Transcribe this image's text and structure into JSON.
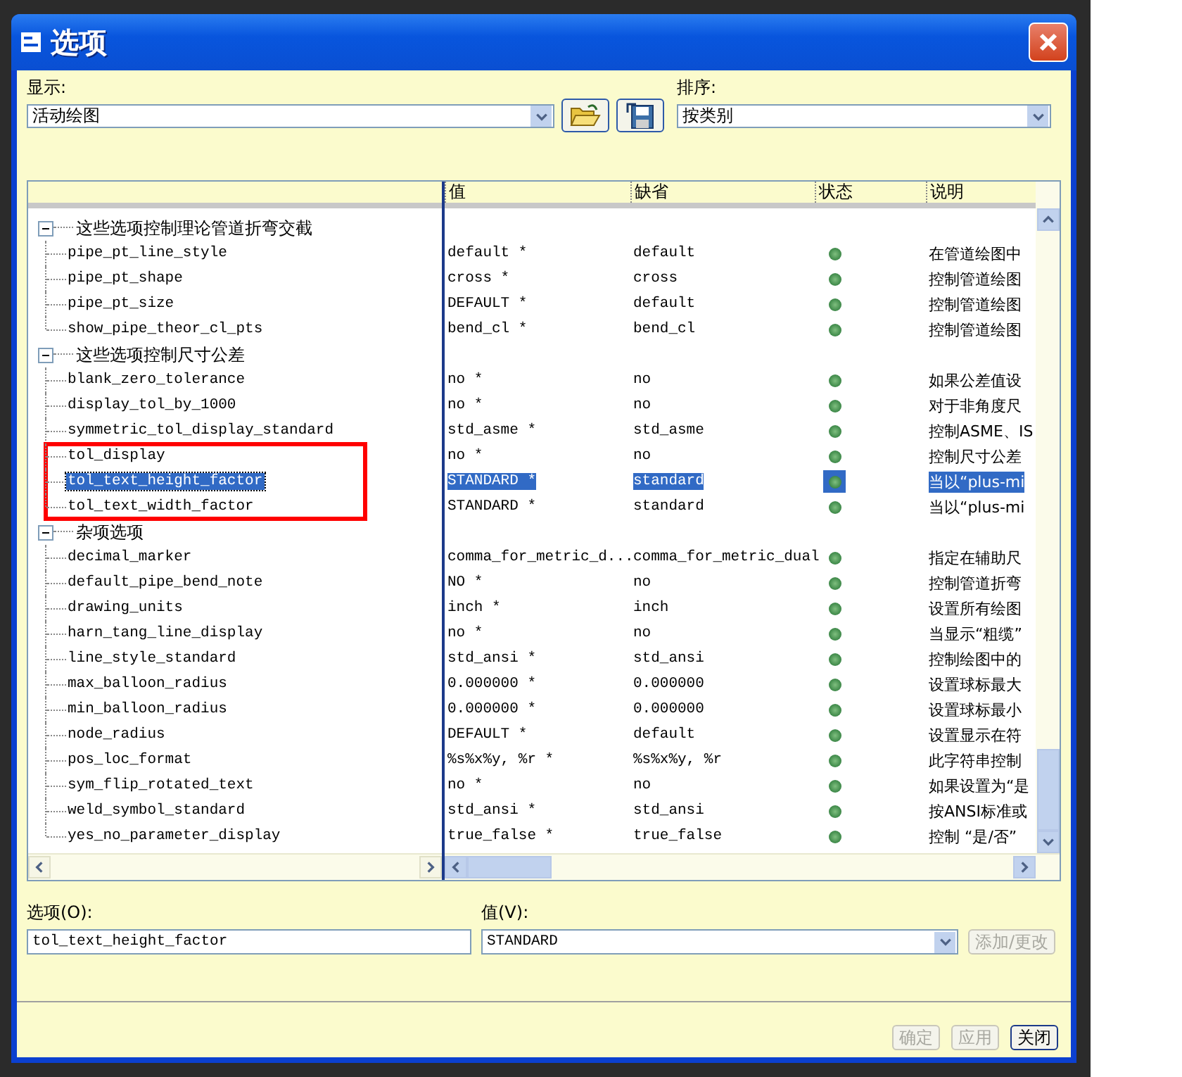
{
  "window": {
    "title": "选项"
  },
  "display": {
    "label": "显示:",
    "value": "活动绘图"
  },
  "sort": {
    "label": "排序:",
    "value": "按类别"
  },
  "table": {
    "columns": [
      "值",
      "缺省",
      "状态",
      "说明"
    ],
    "groups": [
      {
        "label": "这些选项控制理论管道折弯交截",
        "expanded": true,
        "rows": [
          {
            "name": "pipe_pt_line_style",
            "value": "default *",
            "default": "default",
            "description": "在管道绘图中",
            "selected": false,
            "annotated": false
          },
          {
            "name": "pipe_pt_shape",
            "value": "cross *",
            "default": "cross",
            "description": "控制管道绘图",
            "selected": false,
            "annotated": false
          },
          {
            "name": "pipe_pt_size",
            "value": "DEFAULT *",
            "default": "default",
            "description": "控制管道绘图",
            "selected": false,
            "annotated": false
          },
          {
            "name": "show_pipe_theor_cl_pts",
            "value": "bend_cl *",
            "default": "bend_cl",
            "description": "控制管道绘图",
            "selected": false,
            "annotated": false
          }
        ]
      },
      {
        "label": "这些选项控制尺寸公差",
        "expanded": true,
        "rows": [
          {
            "name": "blank_zero_tolerance",
            "value": "no *",
            "default": "no",
            "description": "如果公差值设",
            "selected": false,
            "annotated": false
          },
          {
            "name": "display_tol_by_1000",
            "value": "no *",
            "default": "no",
            "description": "对于非角度尺",
            "selected": false,
            "annotated": false
          },
          {
            "name": "symmetric_tol_display_standard",
            "value": "std_asme *",
            "default": "std_asme",
            "description": "控制ASME、IS",
            "selected": false,
            "annotated": false
          },
          {
            "name": "tol_display",
            "value": "no *",
            "default": "no",
            "description": "控制尺寸公差",
            "selected": false,
            "annotated": true
          },
          {
            "name": "tol_text_height_factor",
            "value": "STANDARD *",
            "default": "standard",
            "description": "当以“plus-mi",
            "selected": true,
            "annotated": true
          },
          {
            "name": "tol_text_width_factor",
            "value": "STANDARD *",
            "default": "standard",
            "description": "当以“plus-mi",
            "selected": false,
            "annotated": true
          }
        ]
      },
      {
        "label": "杂项选项",
        "expanded": true,
        "rows": [
          {
            "name": "decimal_marker",
            "value": "comma_for_metric_d...",
            "default": "comma_for_metric_dual",
            "description": "指定在辅助尺",
            "selected": false,
            "annotated": false
          },
          {
            "name": "default_pipe_bend_note",
            "value": "NO *",
            "default": "no",
            "description": "控制管道折弯",
            "selected": false,
            "annotated": false
          },
          {
            "name": "drawing_units",
            "value": "inch *",
            "default": "inch",
            "description": "设置所有绘图",
            "selected": false,
            "annotated": false
          },
          {
            "name": "harn_tang_line_display",
            "value": "no *",
            "default": "no",
            "description": "当显示“粗缆”",
            "selected": false,
            "annotated": false
          },
          {
            "name": "line_style_standard",
            "value": "std_ansi *",
            "default": "std_ansi",
            "description": "控制绘图中的",
            "selected": false,
            "annotated": false
          },
          {
            "name": "max_balloon_radius",
            "value": "0.000000 *",
            "default": "0.000000",
            "description": "设置球标最大",
            "selected": false,
            "annotated": false
          },
          {
            "name": "min_balloon_radius",
            "value": "0.000000 *",
            "default": "0.000000",
            "description": "设置球标最小",
            "selected": false,
            "annotated": false
          },
          {
            "name": "node_radius",
            "value": "DEFAULT *",
            "default": "default",
            "description": "设置显示在符",
            "selected": false,
            "annotated": false
          },
          {
            "name": "pos_loc_format",
            "value": "%s%x%y, %r *",
            "default": "%s%x%y, %r",
            "description": "此字符串控制",
            "selected": false,
            "annotated": false
          },
          {
            "name": "sym_flip_rotated_text",
            "value": "no *",
            "default": "no",
            "description": "如果设置为“是",
            "selected": false,
            "annotated": false
          },
          {
            "name": "weld_symbol_standard",
            "value": "std_ansi *",
            "default": "std_ansi",
            "description": "按ANSI标准或",
            "selected": false,
            "annotated": false
          },
          {
            "name": "yes_no_parameter_display",
            "value": "true_false *",
            "default": "true_false",
            "description": "控制 “是/否”",
            "selected": false,
            "annotated": false
          }
        ]
      }
    ]
  },
  "option_field": {
    "label": "选项(O):",
    "value": "tol_text_height_factor"
  },
  "value_field": {
    "label": "值(V):",
    "value": "STANDARD"
  },
  "add_button": {
    "label": "添加/更改",
    "disabled": true
  },
  "buttons": [
    {
      "label": "确定",
      "disabled": true
    },
    {
      "label": "应用",
      "disabled": true
    },
    {
      "label": "关闭",
      "disabled": false
    }
  ]
}
